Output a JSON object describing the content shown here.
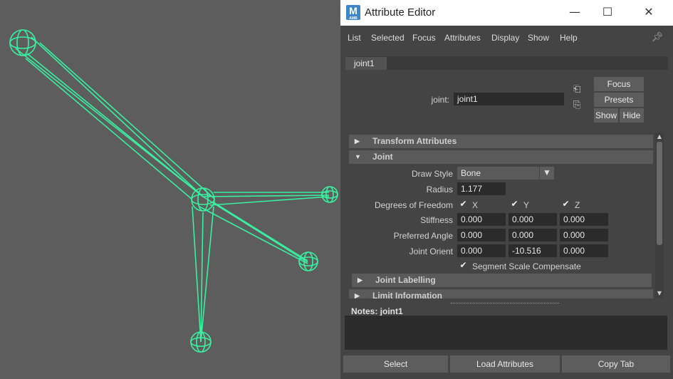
{
  "window": {
    "app_icon_letter": "M",
    "app_icon_sub": "AMB",
    "title": "Attribute Editor",
    "minimize": "—",
    "maximize": "☐",
    "close": "✕"
  },
  "menu": [
    "List",
    "Selected",
    "Focus",
    "Attributes",
    "Display",
    "Show",
    "Help"
  ],
  "tabs": [
    {
      "label": "joint1"
    }
  ],
  "node": {
    "label": "joint:",
    "name": "joint1",
    "focus_btn": "Focus",
    "presets_btn": "Presets",
    "show_btn": "Show",
    "hide_btn": "Hide"
  },
  "sections": {
    "transform": "Transform Attributes",
    "joint": "Joint",
    "labelling": "Joint Labelling",
    "limit": "Limit Information"
  },
  "joint": {
    "draw_style_label": "Draw Style",
    "draw_style_value": "Bone",
    "radius_label": "Radius",
    "radius_value": "1.177",
    "dof_label": "Degrees of Freedom",
    "dof_x": "X",
    "dof_y": "Y",
    "dof_z": "Z",
    "stiffness_label": "Stiffness",
    "stiffness": [
      "0.000",
      "0.000",
      "0.000"
    ],
    "pref_angle_label": "Preferred Angle",
    "pref_angle": [
      "0.000",
      "0.000",
      "0.000"
    ],
    "orient_label": "Joint Orient",
    "orient": [
      "0.000",
      "-10.516",
      "0.000"
    ],
    "ssc_label": "Segment Scale Compensate"
  },
  "notes": {
    "label": "Notes:  joint1"
  },
  "bottom": {
    "select": "Select",
    "load": "Load Attributes",
    "copy": "Copy Tab"
  },
  "colors": {
    "bone": "#39f0a0",
    "viewport_bg": "#5d5d5d",
    "panel_bg": "#444444"
  }
}
